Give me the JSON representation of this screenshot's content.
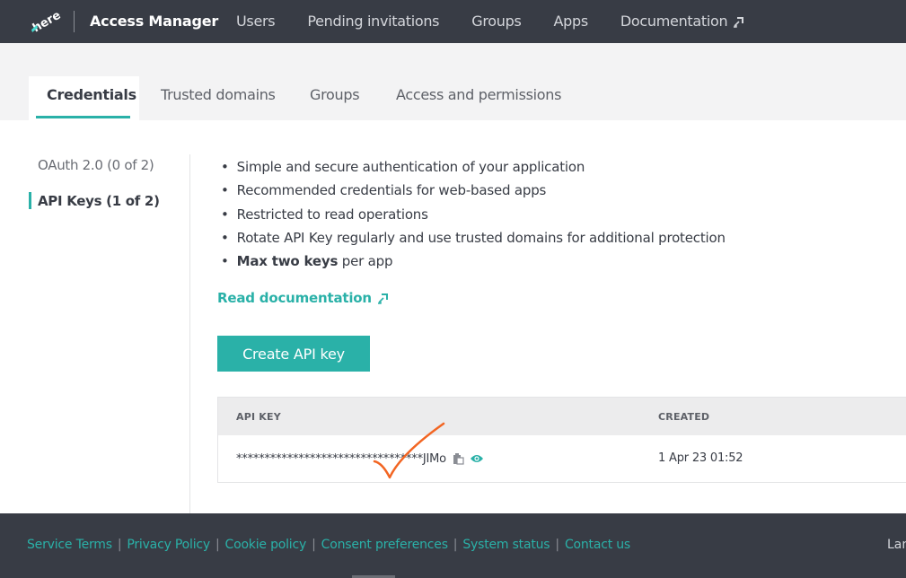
{
  "header": {
    "logo": "here",
    "app_title": "Access Manager",
    "nav": [
      "Users",
      "Pending invitations",
      "Groups",
      "Apps",
      "Documentation"
    ]
  },
  "tabs": [
    {
      "label": "Credentials",
      "active": true
    },
    {
      "label": "Trusted domains",
      "active": false
    },
    {
      "label": "Groups",
      "active": false
    },
    {
      "label": "Access and permissions",
      "active": false
    }
  ],
  "sidebar": {
    "items": [
      {
        "label": "OAuth 2.0 (0 of 2)",
        "active": false
      },
      {
        "label": "API Keys (1 of 2)",
        "active": true
      }
    ]
  },
  "main": {
    "bullets": [
      "Simple and secure authentication of your application",
      "Recommended credentials for web-based apps",
      "Restricted to read operations",
      "Rotate API Key regularly and use trusted domains for additional protection"
    ],
    "last_bullet_bold": "Max two keys",
    "last_bullet_rest": " per app",
    "read_doc": "Read documentation",
    "create_button": "Create API key"
  },
  "table": {
    "columns": [
      "API KEY",
      "CREATED"
    ],
    "rows": [
      {
        "api_key": "*********************************JIMo",
        "created": "1 Apr 23 01:52"
      }
    ]
  },
  "footer": {
    "links": [
      "Service Terms",
      "Privacy Policy",
      "Cookie policy",
      "Consent preferences",
      "System status",
      "Contact us"
    ],
    "lang": "Lan"
  },
  "colors": {
    "accent": "#2ab1a8",
    "header_bg": "#383c45",
    "annotation": "#f26522"
  },
  "icons": [
    "here-logo",
    "external-link-icon",
    "copy-icon",
    "eye-icon"
  ]
}
